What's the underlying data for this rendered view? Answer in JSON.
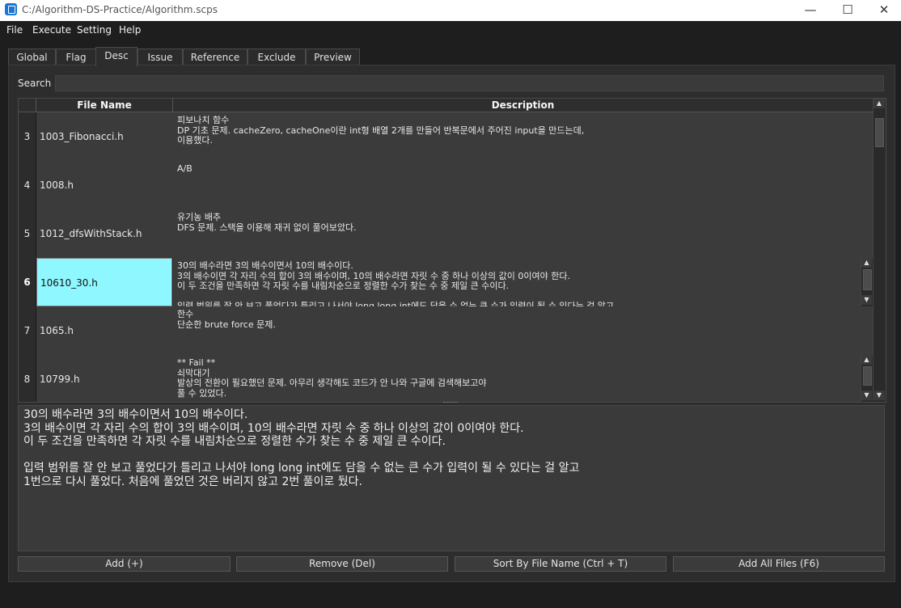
{
  "window": {
    "title": "C:/Algorithm-DS-Practice/Algorithm.scps",
    "controls": [
      "—",
      "☐",
      "✕"
    ]
  },
  "menu": [
    "File",
    "Execute",
    "Setting",
    "Help"
  ],
  "tabs": [
    {
      "label": "Global",
      "active": false
    },
    {
      "label": "Flag",
      "active": false
    },
    {
      "label": "Desc",
      "active": true
    },
    {
      "label": "Issue",
      "active": false
    },
    {
      "label": "Reference",
      "active": false
    },
    {
      "label": "Exclude",
      "active": false
    },
    {
      "label": "Preview",
      "active": false
    }
  ],
  "search": {
    "label": "Search",
    "value": ""
  },
  "table": {
    "headers": [
      "File Name",
      "Description"
    ],
    "rows": [
      {
        "num": "3",
        "file": "1003_Fibonacci.h",
        "desc": "피보나치 함수\nDP 기초 문제. cacheZero, cacheOne이란 int형 배열 2개를 만들어 반복문에서 주어진 input을 만드는데,\n이용했다."
      },
      {
        "num": "4",
        "file": "1008.h",
        "desc": "A/B"
      },
      {
        "num": "5",
        "file": "1012_dfsWithStack.h",
        "desc": "유기농 배추\nDFS 문제. 스택을 이용해 재귀 없이 풀어보았다."
      },
      {
        "num": "6",
        "file": "10610_30.h",
        "desc": "30의 배수라면 3의 배수이면서 10의 배수이다.\n3의 배수이면 각 자리 수의 합이 3의 배수이며, 10의 배수라면 자릿 수 중 하나 이상의 값이 0이여야 한다.\n이 두 조건을 만족하면 각 자릿 수를 내림차순으로 정렬한 수가 찾는 수 중 제일 큰 수이다.\n\n입력 범위를 잘 안 보고 풀었다가 틀리고 나서야 long long int에도 담을 수 없는 큰 수가 입력이 될 수 있다는 걸 알고",
        "selected": true
      },
      {
        "num": "7",
        "file": "1065.h",
        "desc": "한수\n단순한 brute force 문제."
      },
      {
        "num": "8",
        "file": "10799.h",
        "desc": "** Fail **\n쇠막대기\n발상의 전환이 필요했던 문제. 아무리 생각해도 코드가 안 나와 구글에 검색해보고야\n풀 수 있었다."
      }
    ]
  },
  "detail_text": "30의 배수라면 3의 배수이면서 10의 배수이다.\n3의 배수이면 각 자리 수의 합이 3의 배수이며, 10의 배수라면 자릿 수 중 하나 이상의 값이 0이여야 한다.\n이 두 조건을 만족하면 각 자릿 수를 내림차순으로 정렬한 수가 찾는 수 중 제일 큰 수이다.\n\n입력 범위를 잘 안 보고 풀었다가 틀리고 나서야 long long int에도 담을 수 없는 큰 수가 입력이 될 수 있다는 걸 알고\n1번으로 다시 풀었다. 처음에 풀었던 것은 버리지 않고 2번 풀이로 뒀다.",
  "buttons": [
    "Add (+)",
    "Remove (Del)",
    "Sort By File Name (Ctrl + T)",
    "Add All Files (F6)"
  ],
  "colors": {
    "selected_cell": "#8ff7ff",
    "background": "#1e1e1e",
    "panel": "#2d2d2d"
  }
}
